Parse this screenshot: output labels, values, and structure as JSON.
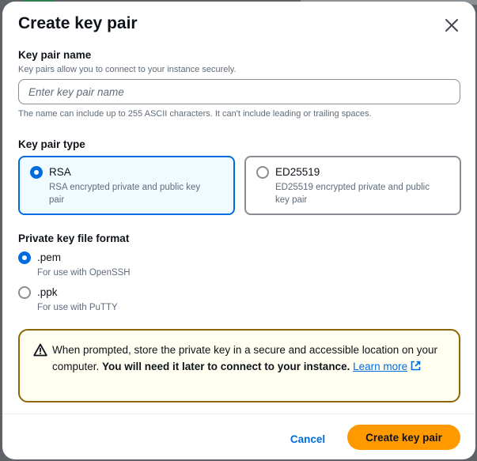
{
  "modal": {
    "title": "Create key pair"
  },
  "key_pair_name": {
    "label": "Key pair name",
    "description": "Key pairs allow you to connect to your instance securely.",
    "placeholder": "Enter key pair name",
    "value": "",
    "constraint": "The name can include up to 255 ASCII characters. It can't include leading or trailing spaces."
  },
  "key_pair_type": {
    "label": "Key pair type",
    "selected": "RSA",
    "options": [
      {
        "title": "RSA",
        "desc_line1": "RSA encrypted private and public key",
        "desc_line2": "pair"
      },
      {
        "title": "ED25519",
        "desc_line1": "ED25519 encrypted private and public",
        "desc_line2": "key pair"
      }
    ]
  },
  "file_format": {
    "label": "Private key file format",
    "selected": ".pem",
    "options": [
      {
        "title": ".pem",
        "desc": "For use with OpenSSH"
      },
      {
        "title": ".ppk",
        "desc": "For use with PuTTY"
      }
    ]
  },
  "warning": {
    "text": "When prompted, store the private key in a secure and accessible location on your computer. ",
    "bold": "You will need it later to connect to your instance.",
    "link": "Learn more",
    "icon": "warning-icon"
  },
  "footer": {
    "cancel_label": "Cancel",
    "create_label": "Create key pair"
  },
  "colors": {
    "accent": "#006ce0",
    "primary_button": "#ff9900",
    "warning_border": "#8d6605",
    "warning_background": "#fffef0",
    "selected_tile_background": "#f0fbff"
  }
}
